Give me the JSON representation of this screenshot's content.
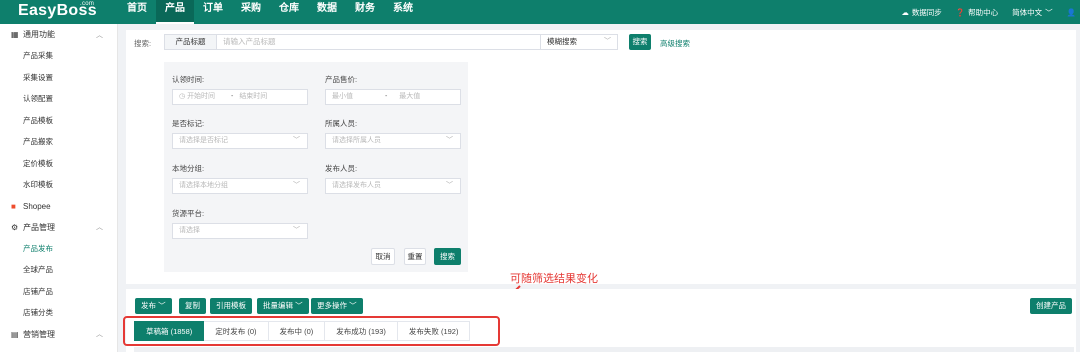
{
  "app": {
    "logo": "EasyBoss",
    "logo_sup": ".com"
  },
  "topnav": {
    "items": [
      "首页",
      "产品",
      "订单",
      "采购",
      "仓库",
      "数据",
      "财务",
      "系统"
    ],
    "active_index": 1
  },
  "topright": {
    "sync": "数据同步",
    "help": "帮助中心",
    "lang": "简体中文"
  },
  "sidebar": {
    "general": "通用功能",
    "general_items": [
      "产品采集",
      "采集设置",
      "认领配置",
      "产品模板",
      "产品搬家",
      "定价模板",
      "水印模板"
    ],
    "shopee": "Shopee",
    "product_mgmt": "产品管理",
    "product_items": [
      "产品发布",
      "全球产品",
      "店铺产品",
      "店铺分类"
    ],
    "active_item": "产品发布",
    "marketing": "营销管理"
  },
  "search": {
    "label": "搜索:",
    "type_value": "产品标题",
    "placeholder": "请输入产品标题",
    "mode": "模糊搜索",
    "button": "搜索",
    "advanced": "高级搜索"
  },
  "filters": {
    "claim_time": {
      "label": "认领时间:",
      "start": "开始时间",
      "sep": "-",
      "end": "结束时间"
    },
    "price": {
      "label": "产品售价:",
      "min": "最小值",
      "sep": "-",
      "max": "最大值"
    },
    "marked": {
      "label": "是否标记:",
      "placeholder": "请选择是否标记"
    },
    "owner": {
      "label": "所属人员:",
      "placeholder": "请选择所属人员"
    },
    "local_group": {
      "label": "本地分组:",
      "placeholder": "请选择本地分组"
    },
    "publisher": {
      "label": "发布人员:",
      "placeholder": "请选择发布人员"
    },
    "source": {
      "label": "货源平台:",
      "placeholder": "请选择"
    },
    "cancel": "取消",
    "reset": "重置",
    "search": "搜索"
  },
  "actions": {
    "publish": "发布",
    "copy": "复制",
    "use_template": "引用模板",
    "batch_edit": "批量编辑",
    "more": "更多操作",
    "create": "创建产品"
  },
  "tabs": [
    {
      "label": "草稿箱 (1858)",
      "active": true
    },
    {
      "label": "定时发布 (0)",
      "active": false
    },
    {
      "label": "发布中 (0)",
      "active": false
    },
    {
      "label": "发布成功 (193)",
      "active": false
    },
    {
      "label": "发布失败 (192)",
      "active": false
    }
  ],
  "annotation": "可随筛选结果变化",
  "colors": {
    "brand": "#0e7f6c",
    "annotation": "#e53935"
  }
}
